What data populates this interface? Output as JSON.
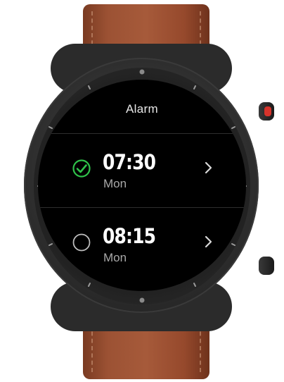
{
  "screen": {
    "title": "Alarm"
  },
  "alarms": [
    {
      "time": "07:30",
      "day": "Mon",
      "enabled": true
    },
    {
      "time": "08:15",
      "day": "Mon",
      "enabled": false
    }
  ],
  "colors": {
    "check_accent": "#2fc24a",
    "screen_bg": "#000000",
    "crown_accent": "#d6332b"
  },
  "icons": {
    "enabled": "checkmark-circle-icon",
    "disabled": "empty-circle-icon",
    "navigate": "chevron-right-icon"
  }
}
